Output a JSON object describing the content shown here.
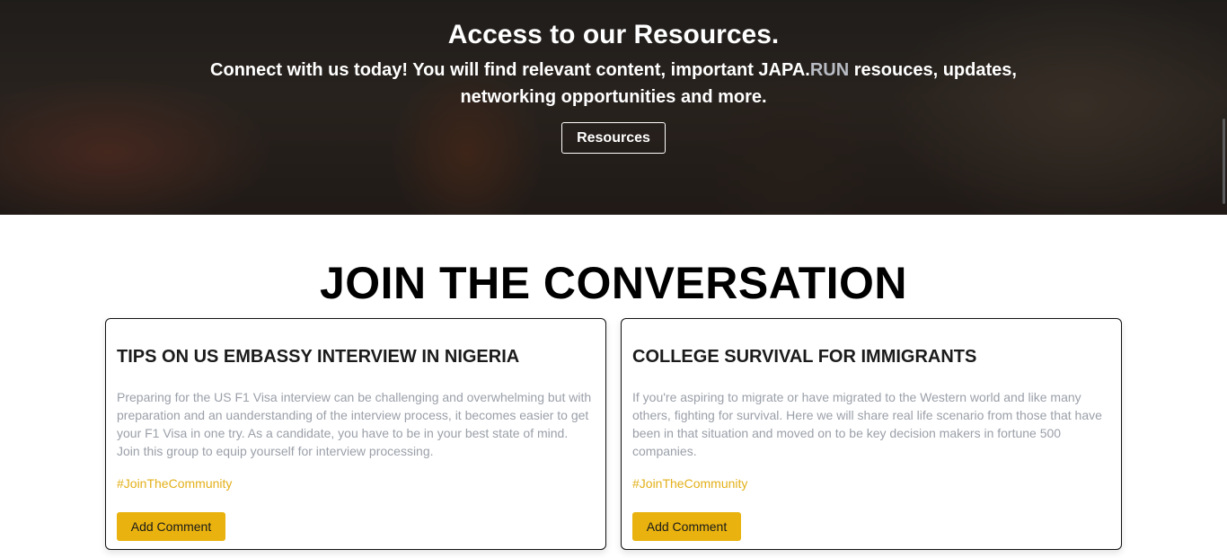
{
  "hero": {
    "title": "Access to our Resources.",
    "subtitle_part1": "Connect with us today! You will find relevant content, important JAPA.",
    "subtitle_accent": "RUN",
    "subtitle_part2": " resouces, updates, networking opportunities and more.",
    "button_label": "Resources"
  },
  "section": {
    "title": "JOIN THE CONVERSATION"
  },
  "cards": [
    {
      "title": "TIPS ON US EMBASSY INTERVIEW IN NIGERIA",
      "text": "Preparing for the US F1 Visa interview can be challenging and overwhelming but with preparation and an uanderstanding of the interview process, it becomes easier to get your F1 Visa in one try. As a candidate, you have to be in your best state of mind. Join this group to equip yourself for interview processing.",
      "tag": "#JoinTheCommunity",
      "button_label": "Add Comment"
    },
    {
      "title": "COLLEGE SURVIVAL FOR IMMIGRANTS",
      "text": "If you're aspiring to migrate or have migrated to the Western world and like many others, fighting for survival. Here we will share real life scenario from those that have been in that situation and moved on to be key decision makers in fortune 500 companies.",
      "tag": "#JoinTheCommunity",
      "button_label": "Add Comment"
    }
  ],
  "colors": {
    "accent_yellow": "#e9b20e",
    "tag_yellow": "#e3b019",
    "muted_text": "#9a9fa8"
  }
}
